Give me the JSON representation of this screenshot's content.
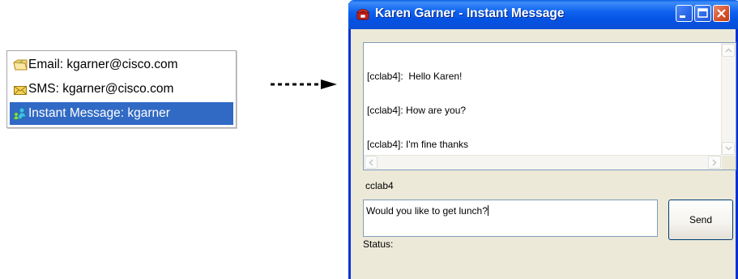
{
  "context_menu": {
    "items": [
      {
        "label": "Email: kgarner@cisco.com",
        "icon": "email-folder-icon"
      },
      {
        "label": "SMS: kgarner@cisco.com",
        "icon": "envelope-icon"
      },
      {
        "label": "Instant Message: kgarner",
        "icon": "buddy-icon"
      }
    ],
    "selected_index": 2,
    "selected_color": "#316ac5"
  },
  "window": {
    "title": "Karen Garner - Instant Message",
    "titlebar_color": "#0a4fd6",
    "chat_lines": [
      "[cclab4]:  Hello Karen!",
      "[cclab4]: How are you?",
      "[cclab4]: I'm fine thanks"
    ],
    "username_label": "cclab4",
    "message_input_value": "Would you like to get lunch?",
    "send_label": "Send",
    "status_label": "Status:"
  }
}
